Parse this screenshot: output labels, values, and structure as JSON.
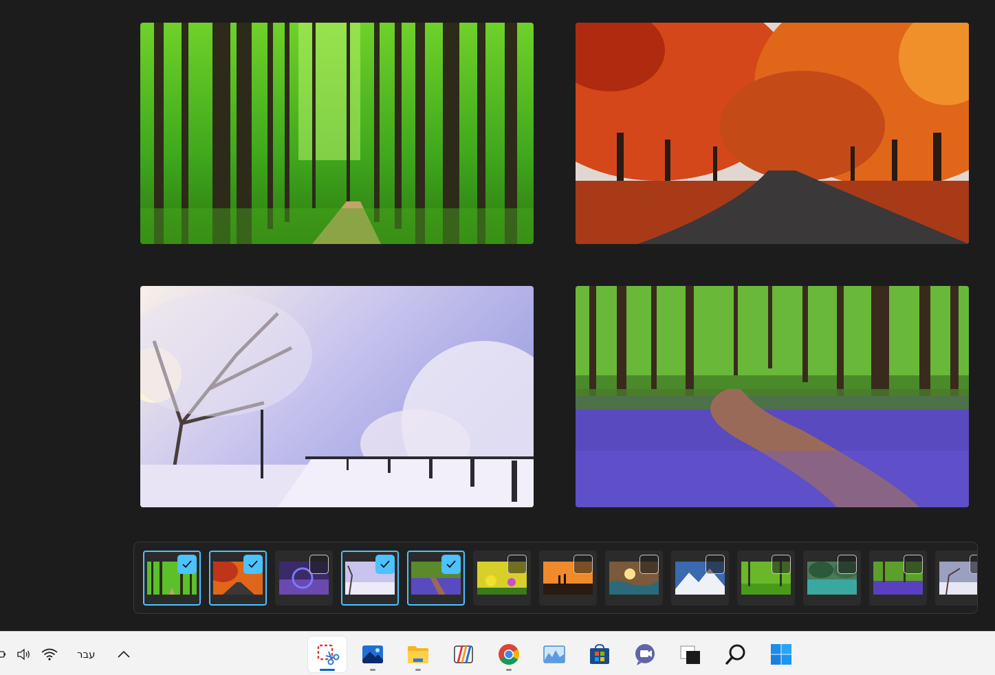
{
  "previews": [
    {
      "name": "green-forest-path",
      "selected": true
    },
    {
      "name": "autumn-road",
      "selected": true
    },
    {
      "name": "snowy-park-walkway",
      "selected": true
    },
    {
      "name": "bluebell-forest-path",
      "selected": true
    }
  ],
  "thumbnails": [
    {
      "name": "green-forest-path",
      "selected": true
    },
    {
      "name": "autumn-road",
      "selected": true
    },
    {
      "name": "purple-abstract",
      "selected": false
    },
    {
      "name": "snowy-park-walkway",
      "selected": true
    },
    {
      "name": "bluebell-forest-path",
      "selected": true
    },
    {
      "name": "yellow-flowers",
      "selected": false
    },
    {
      "name": "sunset-silhouettes",
      "selected": false
    },
    {
      "name": "ocean-wave-sunset",
      "selected": false
    },
    {
      "name": "snowy-mountains",
      "selected": false
    },
    {
      "name": "green-park",
      "selected": false
    },
    {
      "name": "river-forest",
      "selected": false
    },
    {
      "name": "bluebell-meadow",
      "selected": false
    },
    {
      "name": "frosted-trees",
      "selected": false
    }
  ],
  "taskbar": {
    "language": "עבר",
    "apps": [
      {
        "name": "snipping-tool",
        "active": true,
        "running": true
      },
      {
        "name": "photos",
        "active": false,
        "running": true
      },
      {
        "name": "file-explorer",
        "active": false,
        "running": true
      },
      {
        "name": "app-launcher",
        "active": false,
        "running": false
      },
      {
        "name": "chrome",
        "active": false,
        "running": true
      },
      {
        "name": "image-viewer",
        "active": false,
        "running": false
      },
      {
        "name": "microsoft-store",
        "active": false,
        "running": false
      },
      {
        "name": "teams-chat",
        "active": false,
        "running": false
      },
      {
        "name": "task-view",
        "active": false,
        "running": false
      },
      {
        "name": "search",
        "active": false,
        "running": false
      },
      {
        "name": "start",
        "active": false,
        "running": false
      }
    ]
  },
  "colors": {
    "accent": "#4cc2ff",
    "taskbar_indicator": "#0067c0"
  }
}
